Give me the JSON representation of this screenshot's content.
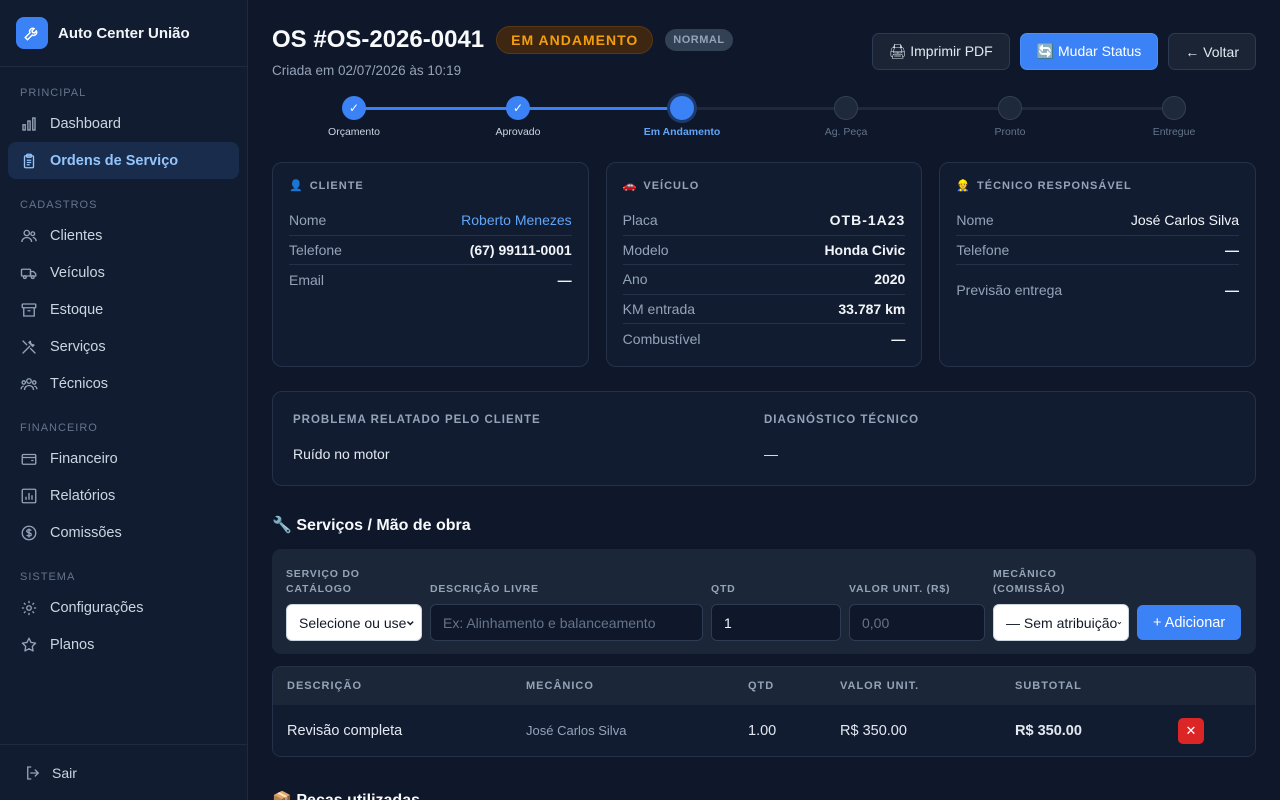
{
  "app": {
    "name": "Auto Center União"
  },
  "sidebar": {
    "sections": [
      "PRINCIPAL",
      "CADASTROS",
      "FINANCEIRO",
      "SISTEMA"
    ],
    "items": [
      {
        "label": "Dashboard",
        "icon": "bar-chart-icon"
      },
      {
        "label": "Ordens de Serviço",
        "icon": "clipboard-icon",
        "active": true
      },
      {
        "label": "Clientes",
        "icon": "users-icon"
      },
      {
        "label": "Veículos",
        "icon": "truck-icon"
      },
      {
        "label": "Estoque",
        "icon": "archive-icon"
      },
      {
        "label": "Serviços",
        "icon": "tools-icon"
      },
      {
        "label": "Técnicos",
        "icon": "team-icon"
      },
      {
        "label": "Financeiro",
        "icon": "wallet-icon"
      },
      {
        "label": "Relatórios",
        "icon": "report-icon"
      },
      {
        "label": "Comissões",
        "icon": "dollar-icon"
      },
      {
        "label": "Configurações",
        "icon": "gear-icon"
      },
      {
        "label": "Planos",
        "icon": "star-icon"
      }
    ],
    "logout": "Sair"
  },
  "header": {
    "title": "OS #OS-2026-0041",
    "status": "EM ANDAMENTO",
    "priority": "NORMAL",
    "created": "Criada em 02/07/2026 às 10:19",
    "print": "🖨 Imprimir PDF",
    "change_status": "🔄 Mudar Status",
    "back": "← Voltar"
  },
  "steps": [
    {
      "label": "Orçamento",
      "state": "done"
    },
    {
      "label": "Aprovado",
      "state": "done"
    },
    {
      "label": "Em Andamento",
      "state": "current"
    },
    {
      "label": "Ag. Peça",
      "state": "todo"
    },
    {
      "label": "Pronto",
      "state": "todo"
    },
    {
      "label": "Entregue",
      "state": "todo"
    }
  ],
  "check": "✓",
  "cliente": {
    "heading": "CLIENTE",
    "rows": [
      {
        "k": "Nome",
        "v": "Roberto Menezes"
      },
      {
        "k": "Telefone",
        "v": "(67) 99111-0001"
      },
      {
        "k": "Email",
        "v": "—"
      }
    ]
  },
  "veiculo": {
    "heading": "VEÍCULO",
    "rows": [
      {
        "k": "Placa",
        "v": "OTB-1A23"
      },
      {
        "k": "Modelo",
        "v": "Honda Civic"
      },
      {
        "k": "Ano",
        "v": "2020"
      },
      {
        "k": "KM entrada",
        "v": "33.787 km"
      },
      {
        "k": "Combustível",
        "v": "—"
      }
    ]
  },
  "tecnico": {
    "heading": "TÉCNICO RESPONSÁVEL",
    "rows": [
      {
        "k": "Nome",
        "v": "José Carlos Silva"
      },
      {
        "k": "Telefone",
        "v": "—"
      },
      {
        "k": "Previsão entrega",
        "v": "—"
      }
    ]
  },
  "problema": {
    "heading": "PROBLEMA RELATADO PELO CLIENTE",
    "value": "Ruído no motor"
  },
  "diagnostico": {
    "heading": "DIAGNÓSTICO TÉCNICO",
    "value": "—"
  },
  "servicos": {
    "title": "🔧 Serviços / Mão de obra",
    "form": {
      "catalogo_label": "SERVIÇO DO CATÁLOGO",
      "catalogo_value": "Selecione ou use",
      "descricao_label": "DESCRIÇÃO LIVRE",
      "descricao_placeholder": "Ex: Alinhamento e balanceamento",
      "qtd_label": "QTD",
      "qtd_value": "1",
      "valor_label": "VALOR UNIT. (R$)",
      "valor_placeholder": "0,00",
      "mecanico_label": "MECÂNICO (COMISSÃO)",
      "mecanico_value": "— Sem atribuição",
      "add": "+ Adicionar"
    },
    "columns": [
      "DESCRIÇÃO",
      "MECÂNICO",
      "QTD",
      "VALOR UNIT.",
      "SUBTOTAL"
    ],
    "rows": [
      {
        "descricao": "Revisão completa",
        "mecanico": "José Carlos Silva",
        "qtd": "1.00",
        "valor": "R$ 350.00",
        "subtotal": "R$ 350.00",
        "delete": "✕"
      }
    ]
  },
  "pecas": {
    "title": "📦 Peças utilizadas"
  },
  "colors": {
    "accent": "#3b82f6",
    "status": "#f59e0b",
    "danger": "#dc2626"
  }
}
